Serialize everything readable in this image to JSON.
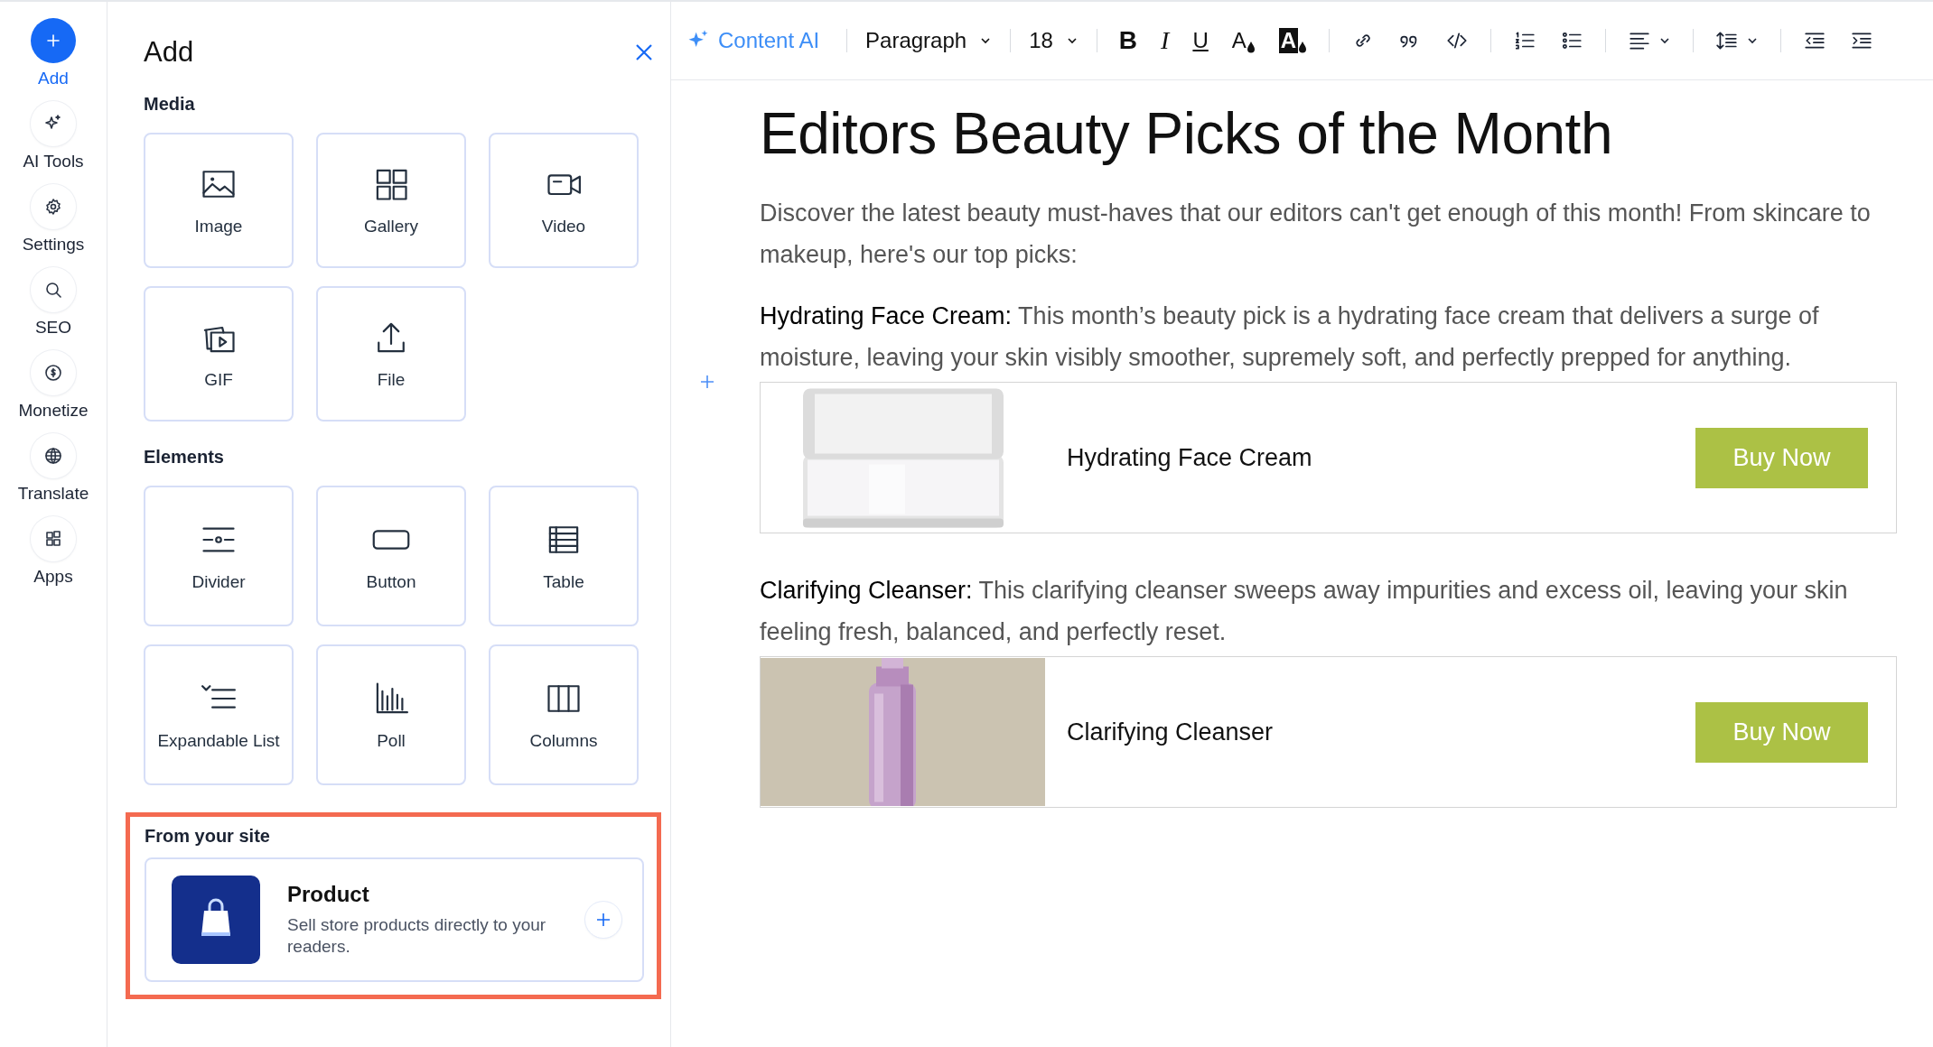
{
  "rail": {
    "items": [
      {
        "label": "Add",
        "selected": true
      },
      {
        "label": "AI Tools",
        "selected": false
      },
      {
        "label": "Settings",
        "selected": false
      },
      {
        "label": "SEO",
        "selected": false
      },
      {
        "label": "Monetize",
        "selected": false
      },
      {
        "label": "Translate",
        "selected": false
      },
      {
        "label": "Apps",
        "selected": false
      }
    ]
  },
  "panel": {
    "title": "Add",
    "sections": [
      {
        "heading": "Media",
        "items": [
          "Image",
          "Gallery",
          "Video",
          "GIF",
          "File"
        ]
      },
      {
        "heading": "Elements",
        "items": [
          "Divider",
          "Button",
          "Table",
          "Expandable List",
          "Poll",
          "Columns"
        ]
      }
    ],
    "from_site": {
      "heading": "From your site",
      "highlighted": true,
      "product": {
        "title": "Product",
        "description": "Sell store products directly to your readers."
      }
    }
  },
  "toolbar": {
    "content_ai": "Content AI",
    "style": "Paragraph",
    "size": "18",
    "format_buttons": [
      {
        "kind": "bold",
        "label": "B"
      },
      {
        "kind": "italic",
        "label": "I"
      },
      {
        "kind": "underline",
        "label": "U"
      },
      {
        "kind": "text-color",
        "label": "A"
      },
      {
        "kind": "highlight",
        "label": "A"
      }
    ]
  },
  "document": {
    "title": "Editors Beauty Picks of the Month",
    "blocks": [
      {
        "kind": "paragraph",
        "text": "Discover the latest beauty must-haves that our editors can't get enough of this month! From skincare to makeup, here's our top picks:"
      },
      {
        "kind": "paragraph",
        "text": "**Hydrating Face Cream:** This month’s beauty pick is a hydrating face cream that delivers a surge of moisture, leaving your skin visibly smoother, supremely soft, and perfectly prepped for anything."
      },
      {
        "kind": "product",
        "name": "Hydrating Face Cream",
        "button": "Buy Now"
      },
      {
        "kind": "paragraph",
        "text": "**Clarifying Cleanser:** This clarifying cleanser sweeps away impurities and excess oil, leaving your skin feeling fresh, balanced, and perfectly reset."
      },
      {
        "kind": "product",
        "name": "Clarifying Cleanser",
        "button": "Buy Now"
      }
    ]
  }
}
